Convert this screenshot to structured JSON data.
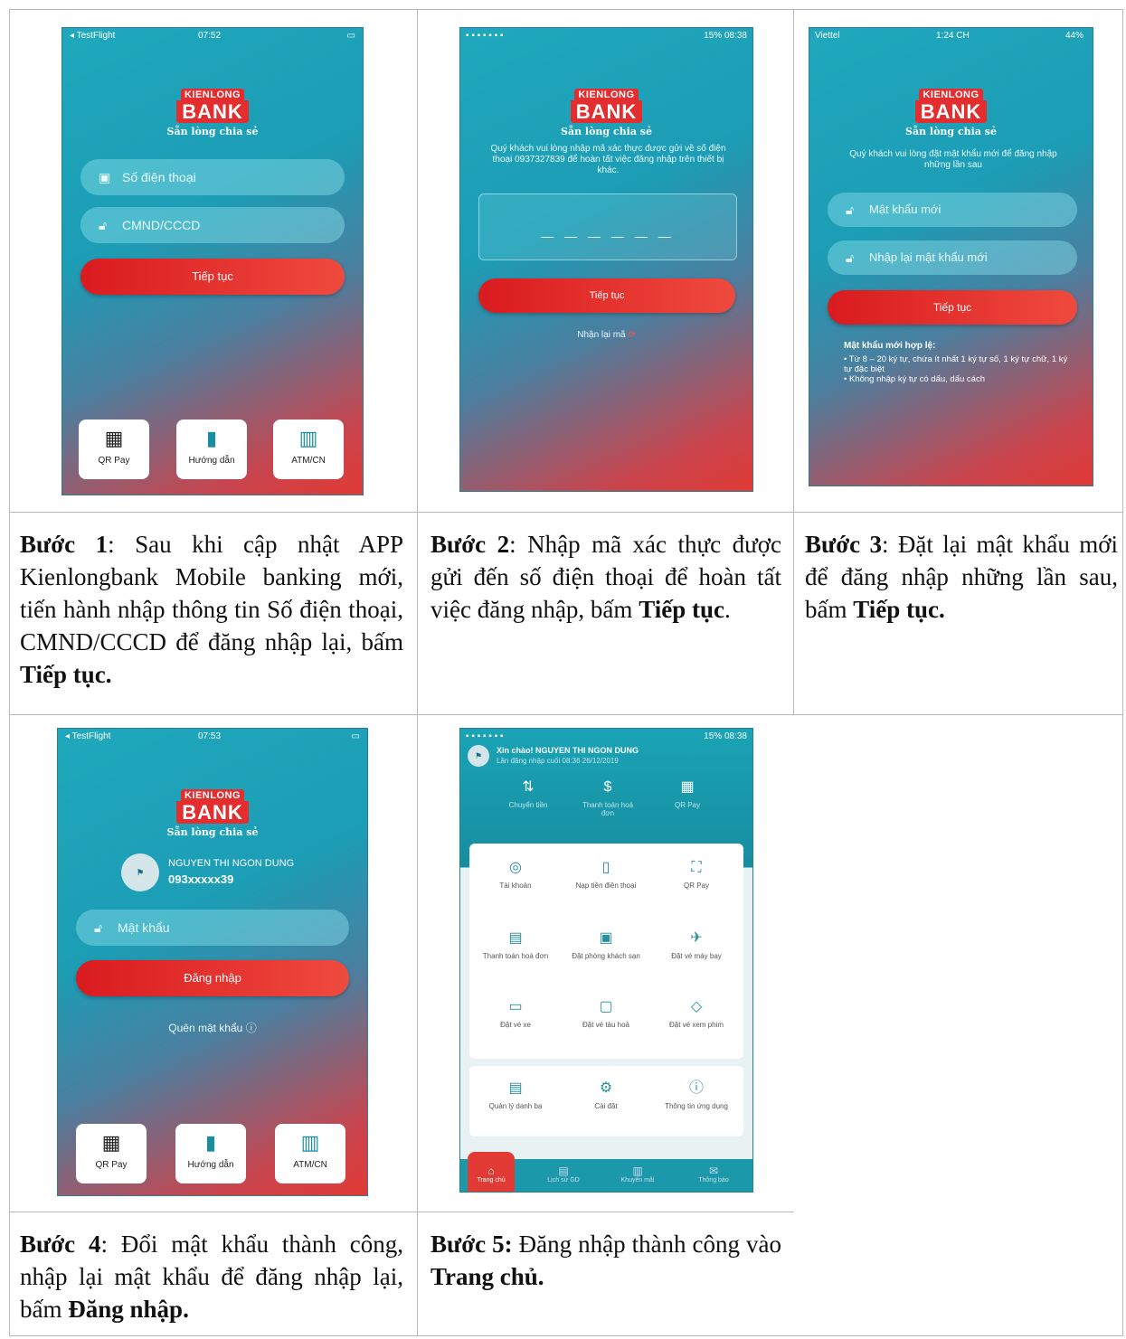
{
  "phone1": {
    "status_left": "◂ TestFlight",
    "status_time": "07:52",
    "logo_top": "KIENLONG",
    "logo_bank": "BANK",
    "tagline": "Sẵn lòng chia sẻ",
    "phone_placeholder": "Số điện thoại",
    "id_placeholder": "CMND/CCCD",
    "continue": "Tiếp tục",
    "quick": [
      "QR Pay",
      "Hướng dẫn",
      "ATM/CN"
    ]
  },
  "phone2": {
    "status_time": "15% 08:38",
    "logo_top": "KIENLONG",
    "logo_bank": "BANK",
    "tagline": "Sẵn lòng chia sẻ",
    "instruction": "Quý khách vui lòng nhập mã xác thực được gửi về số điện thoại 0937327839 để hoàn tất việc đăng nhập trên thiết bị khác.",
    "otp_dashes": "— — — — — —",
    "continue": "Tiếp tục",
    "resend": "Nhận lại mã"
  },
  "phone3": {
    "carrier": "Viettel",
    "status_time": "1:24 CH",
    "battery": "44%",
    "logo_top": "KIENLONG",
    "logo_bank": "BANK",
    "tagline": "Sẵn lòng chia sẻ",
    "instruction": "Quý khách vui lòng đặt mật khẩu mới để đăng nhập những lần sau",
    "new_password": "Mật khẩu mới",
    "confirm_password": "Nhập lại mật khẩu mới",
    "continue": "Tiếp tục",
    "rules_title": "Mật khẩu mới hợp lệ:",
    "rule1": "• Từ 8 – 20 ký tự, chứa ít nhất 1 ký tự số, 1 ký tự chữ, 1 ký tự đặc biệt",
    "rule2": "• Không nhập ký tự có dấu, dấu cách"
  },
  "phone4": {
    "status_left": "◂ TestFlight",
    "status_time": "07:53",
    "logo_top": "KIENLONG",
    "logo_bank": "BANK",
    "tagline": "Sẵn lòng chia sẻ",
    "user_name": "NGUYEN THI NGON DUNG",
    "user_phone": "093xxxxx39",
    "password_placeholder": "Mật khẩu",
    "login": "Đăng nhập",
    "forgot": "Quên mật khẩu",
    "quick": [
      "QR Pay",
      "Hướng dẫn",
      "ATM/CN"
    ]
  },
  "phone5": {
    "status_time": "15% 08:38",
    "greeting": "Xin chào! NGUYEN THI NGON DUNG",
    "last_login": "Lần đăng nhập cuối 08:36 26/12/2019",
    "top_actions": [
      "Chuyển tiền",
      "Thanh toán hoá đơn",
      "QR Pay"
    ],
    "tiles": [
      "Tài khoản",
      "Nạp tiền điện thoại",
      "QR Pay",
      "Thanh toán hoá đơn",
      "Đặt phòng khách sạn",
      "Đặt vé máy bay",
      "Đặt vé xe",
      "Đặt vé tàu hoả",
      "Đặt vé xem phim"
    ],
    "tiles2": [
      "Quản lý danh bạ",
      "Cài đặt",
      "Thông tin ứng dụng"
    ],
    "nav": [
      "Trang chủ",
      "Lịch sử GD",
      "Khuyến mãi",
      "Thông báo"
    ]
  },
  "captions": {
    "step1_label": "Bước 1",
    "step1_text": ": Sau khi cập nhật APP Kienlongbank Mobile banking mới, tiến hành nhập thông tin Số điện thoại, CMND/CCCD để đăng nhập lại, bấm ",
    "step1_bold": "Tiếp tục.",
    "step2_label": "Bước 2",
    "step2_text": ": Nhập mã xác thực được gửi đến số điện thoại để hoàn tất việc đăng nhập, bấm ",
    "step2_bold": "Tiếp tục",
    "step2_end": ".",
    "step3_label": "Bước 3",
    "step3_text": ": Đặt lại mật khẩu mới để đăng nhập những lần sau, bấm ",
    "step3_bold": "Tiếp tục.",
    "step4_label": "Bước 4",
    "step4_text": ": Đổi mật khẩu thành công, nhập lại mật khẩu để đăng nhập lại, bấm ",
    "step4_bold": "Đăng nhập.",
    "step5_label": "Bước 5:",
    "step5_text": " Đăng nhập thành công vào ",
    "step5_bold": "Trang chủ."
  }
}
